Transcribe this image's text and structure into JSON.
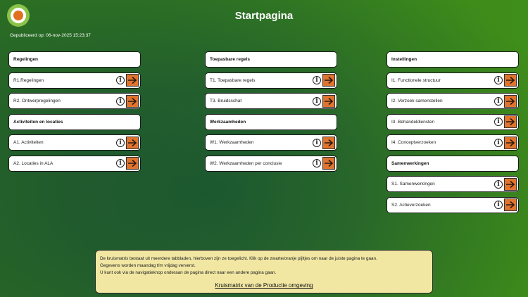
{
  "header": {
    "title": "Startpagina",
    "published": "Gepubliceerd op: 06-nov-2025 15:23:37"
  },
  "columns": [
    {
      "groups": [
        {
          "title": "Regelingen",
          "items": [
            "R1.Regelingen",
            "R2. Ontwerpregelingen"
          ]
        },
        {
          "title": "Activiteiten en locaties",
          "items": [
            "A1. Activiteiten",
            "A2. Locaties in ALA"
          ]
        }
      ]
    },
    {
      "groups": [
        {
          "title": "Toepasbare regels",
          "items": [
            "T1. Toepasbare regels",
            "T3. Bruidsschat"
          ]
        },
        {
          "title": "Werkzaamheden",
          "items": [
            "W1. Werkzaamheden",
            "W2. Werkzaamheden per conclusie"
          ]
        }
      ]
    },
    {
      "groups": [
        {
          "title": "Instellingen",
          "items": [
            "I1. Functionele structuur",
            "I2. Verzoek samenstellen",
            "I3. Behandeldiensten",
            "I4. Conceptverzoeken"
          ]
        },
        {
          "title": "Samenwerkingen",
          "items": [
            "S1. Samenwerkingen",
            "S2. Actieverzoeken"
          ]
        }
      ]
    }
  ],
  "icons": {
    "info": "info-icon",
    "navigate": "arrow-right-icon"
  },
  "colors": {
    "arrow_button": "#e0742f",
    "info_box": "#f1e7a3",
    "logo_ring": "#8bc34a",
    "logo_center": "#e07020"
  },
  "infobox": {
    "line1": "De kruismatrix bestaat uit meerdere tabbladen, hierboven zijn ze toegelicht. Klik op de zwarte/oranje pijltjes om naar de juiste pagina te gaan.",
    "line2": "Gegevens worden maandag t/m vrijdag ververst.",
    "line3": "U kunt ook via de navigatieknop onderaan de pagina direct naar een andere pagina gaan.",
    "link": "Kruismatrix van de Productie omgeving"
  }
}
